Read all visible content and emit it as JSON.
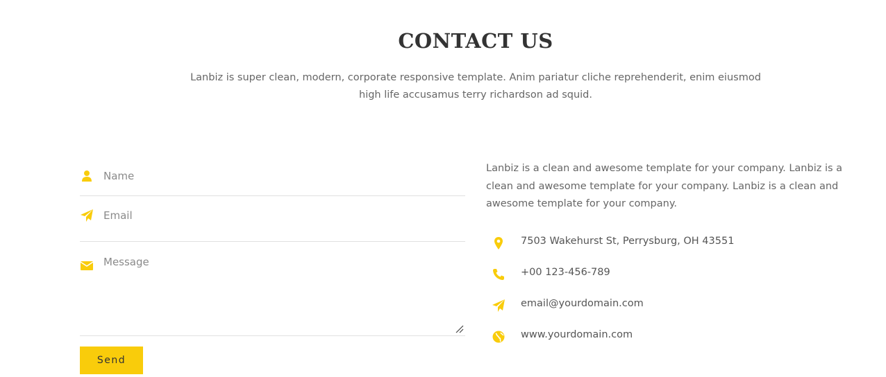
{
  "header": {
    "title": "CONTACT US",
    "subtitle": "Lanbiz is super clean, modern, corporate responsive template. Anim pariatur cliche reprehenderit, enim eiusmod high life accusamus terry richardson ad squid."
  },
  "form": {
    "name_placeholder": "Name",
    "email_placeholder": "Email",
    "message_placeholder": "Message",
    "name_value": "",
    "email_value": "",
    "message_value": "",
    "send_label": "Send",
    "icons": {
      "name": "user-icon",
      "email": "paper-plane-icon",
      "message": "envelope-icon"
    }
  },
  "info": {
    "description": "Lanbiz is a clean and awesome template for your company. Lanbiz is a clean and awesome template for your company. Lanbiz is a clean and awesome template for your company.",
    "items": [
      {
        "icon": "map-marker-icon",
        "value": "7503 Wakehurst St, Perrysburg, OH 43551"
      },
      {
        "icon": "phone-icon",
        "value": "+00 123-456-789"
      },
      {
        "icon": "paper-plane-icon",
        "value": "email@yourdomain.com"
      },
      {
        "icon": "globe-icon",
        "value": "www.yourdomain.com"
      }
    ]
  },
  "colors": {
    "accent": "#f9cc0b",
    "heading": "#333333",
    "text": "#666666",
    "divider": "#e0e0e0"
  }
}
